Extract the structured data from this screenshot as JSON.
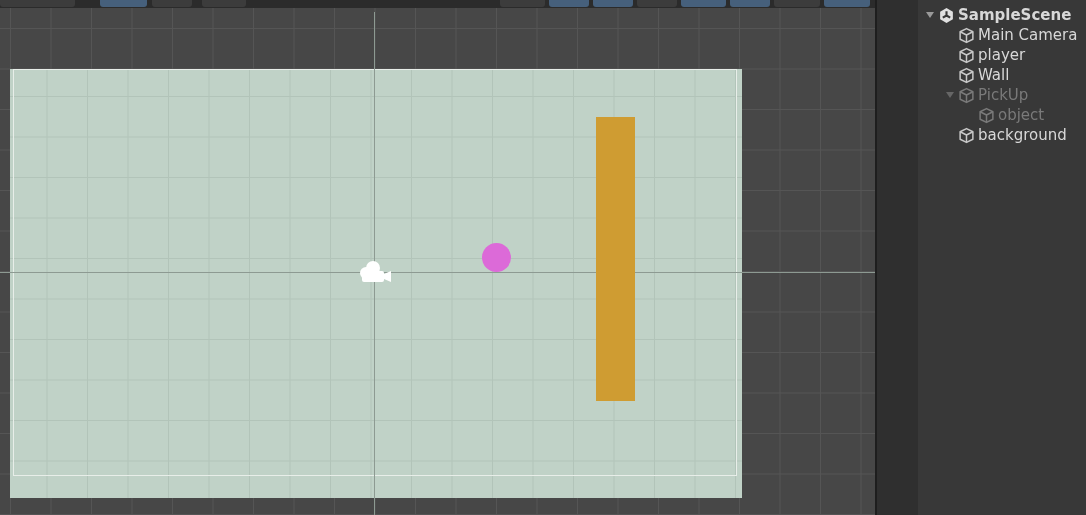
{
  "scene_toolbar": [
    {
      "selected": false
    },
    {
      "selected": true
    },
    {
      "selected": false
    },
    {
      "selected": false
    },
    {
      "selected": false
    },
    {
      "selected": true
    },
    {
      "selected": true
    },
    {
      "selected": false
    },
    {
      "selected": true
    },
    {
      "selected": true
    },
    {
      "selected": false
    },
    {
      "selected": true
    }
  ],
  "hierarchy": {
    "items": [
      {
        "label": "SampleScene",
        "kind": "scene",
        "expanded": true,
        "disabled": false,
        "children": [
          {
            "label": "Main Camera",
            "kind": "object",
            "disabled": false
          },
          {
            "label": "player",
            "kind": "object",
            "disabled": false
          },
          {
            "label": "Wall",
            "kind": "object",
            "disabled": false
          },
          {
            "label": "PickUp",
            "kind": "object",
            "expanded": true,
            "disabled": true,
            "children": [
              {
                "label": "object",
                "kind": "object",
                "disabled": true
              }
            ]
          },
          {
            "label": "background",
            "kind": "object",
            "disabled": false
          }
        ]
      }
    ]
  }
}
